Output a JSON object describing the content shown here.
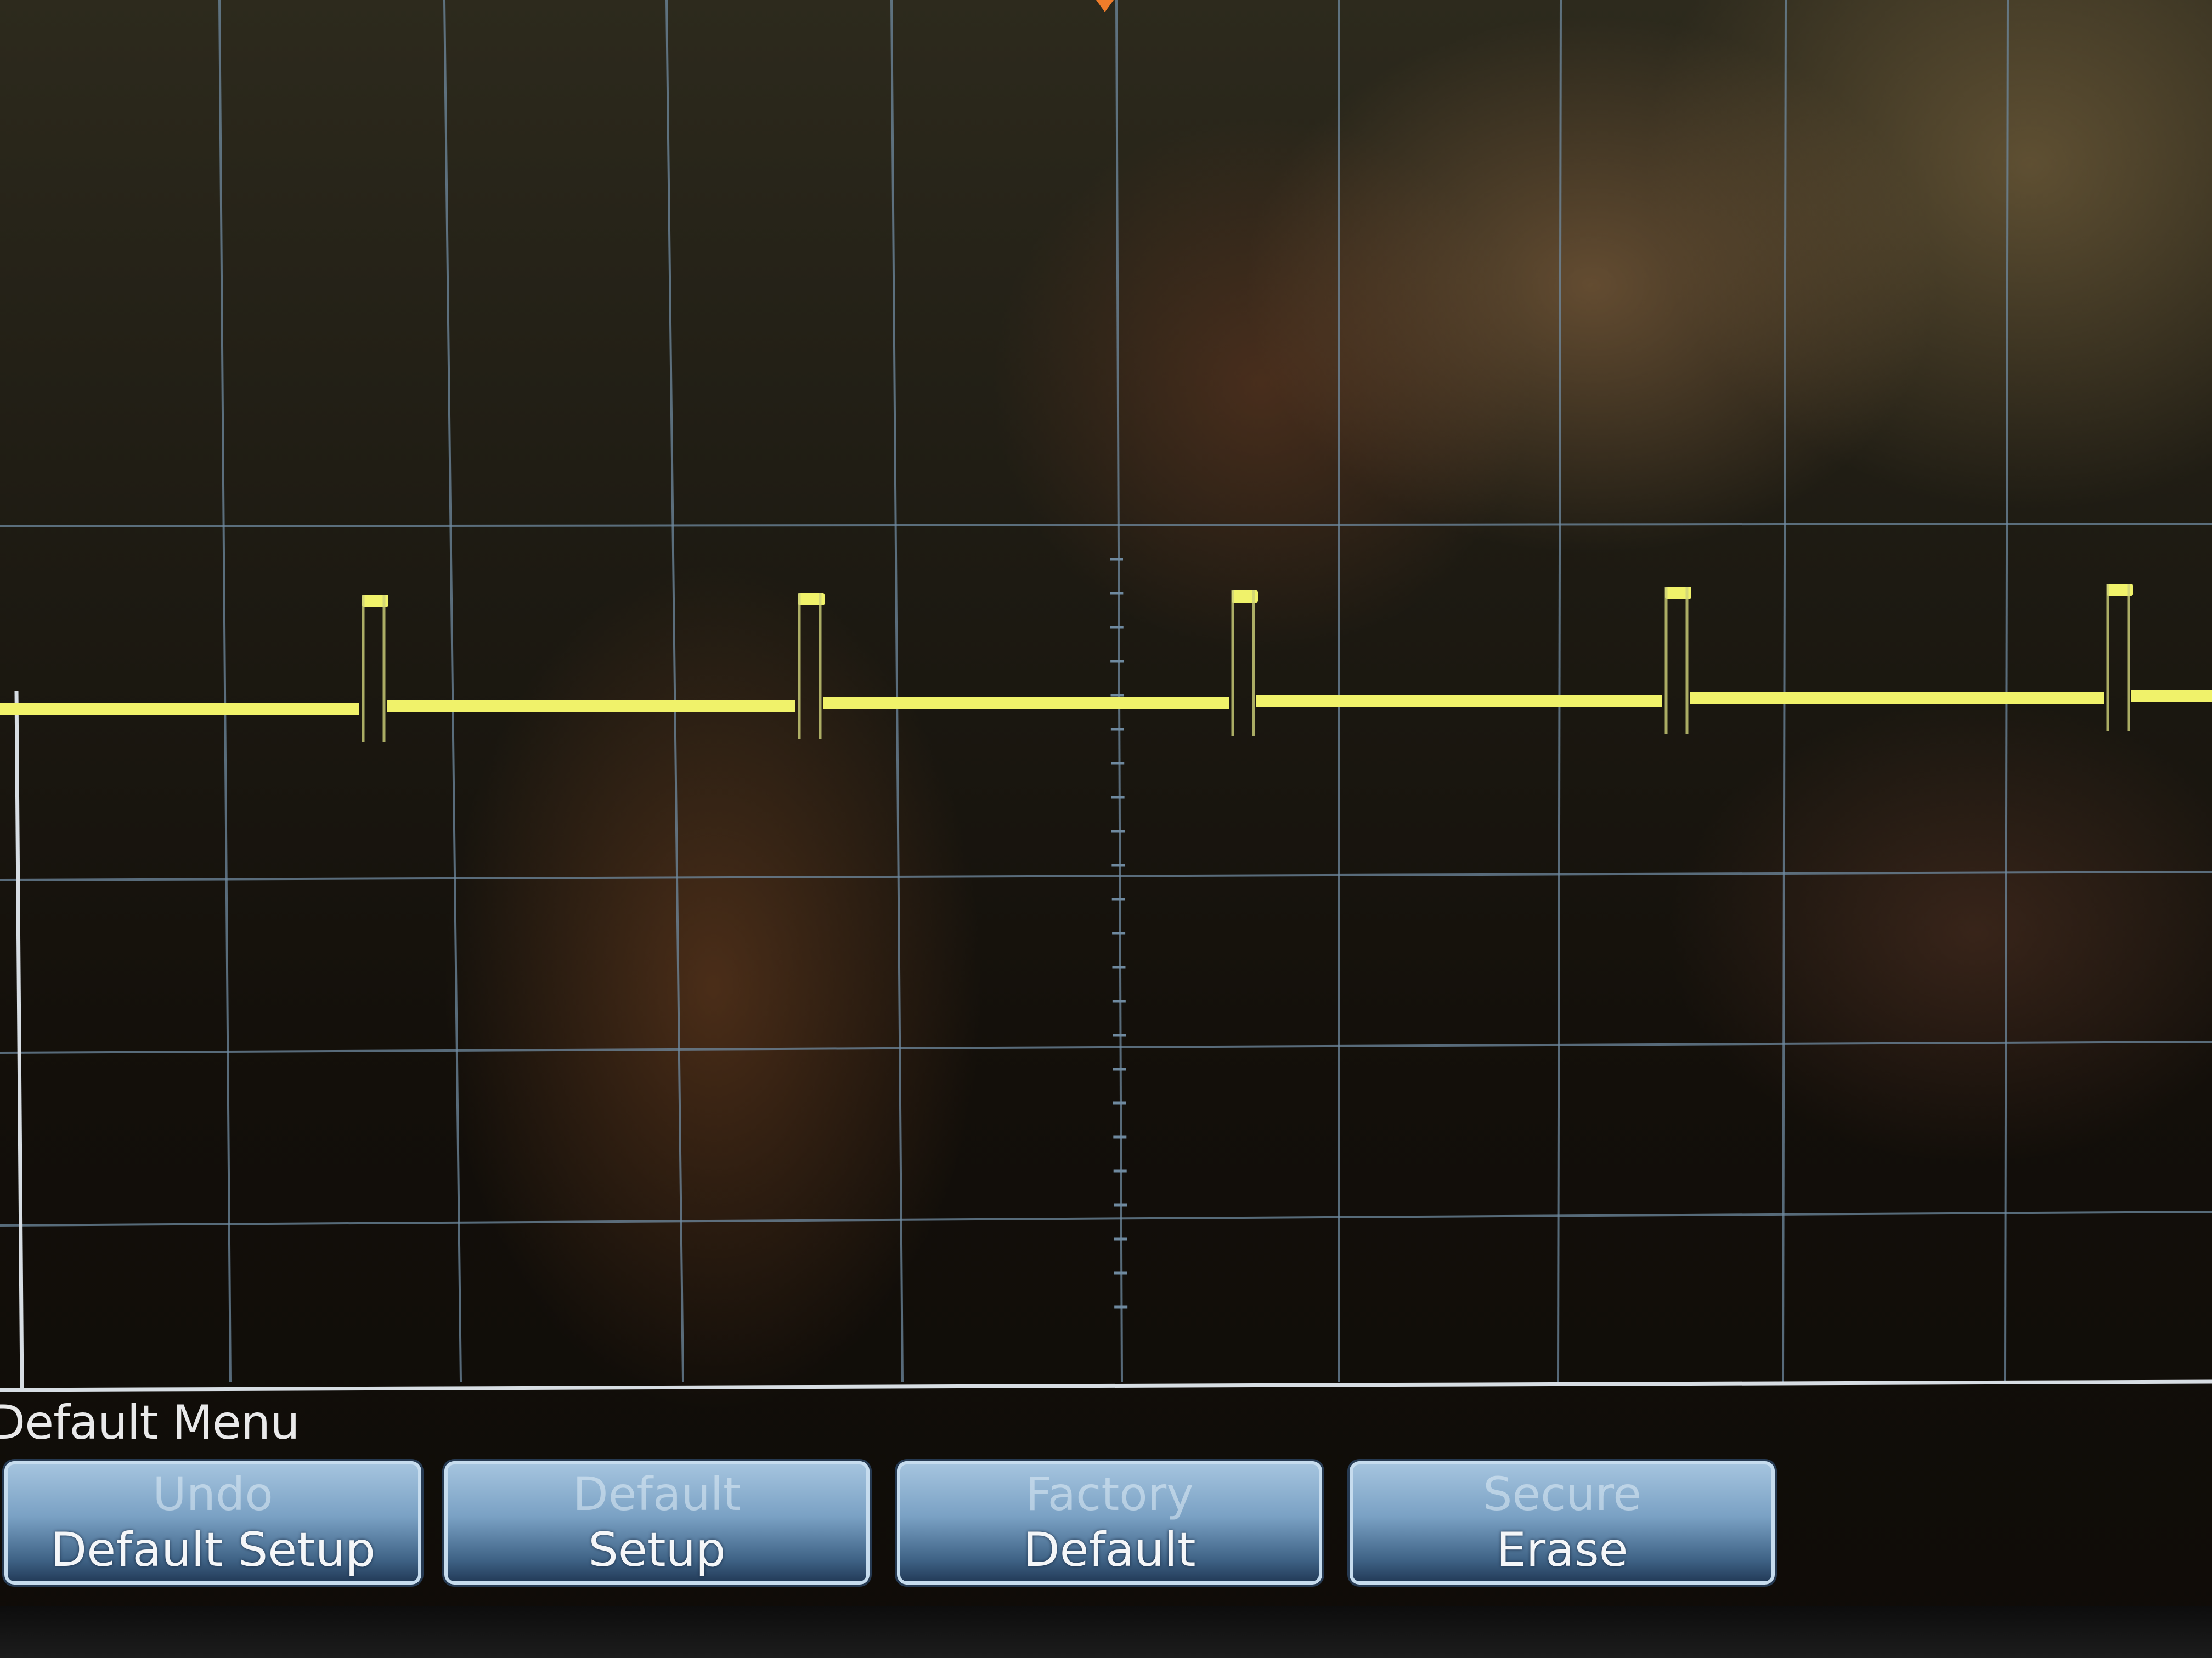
{
  "menu": {
    "title": "Default Menu",
    "softkeys": [
      {
        "top": "Undo",
        "bottom": "Default Setup",
        "enabled": false
      },
      {
        "top": "Default",
        "bottom": "Setup",
        "enabled": true
      },
      {
        "top": "Factory",
        "bottom": "Default",
        "enabled": true
      },
      {
        "top": "Secure",
        "bottom": "Erase",
        "enabled": true
      }
    ]
  },
  "colors": {
    "trace": "#f0f26a",
    "grid": "#6f8aa0",
    "softkey_top": "#a7c6e0",
    "softkey_bottom": "#1f3652",
    "text": "#e9e9ea"
  },
  "waveform": {
    "description_channel": "yellow trace",
    "pulse_count": 5,
    "pulse_polarity": "positive spike with brief gap"
  }
}
